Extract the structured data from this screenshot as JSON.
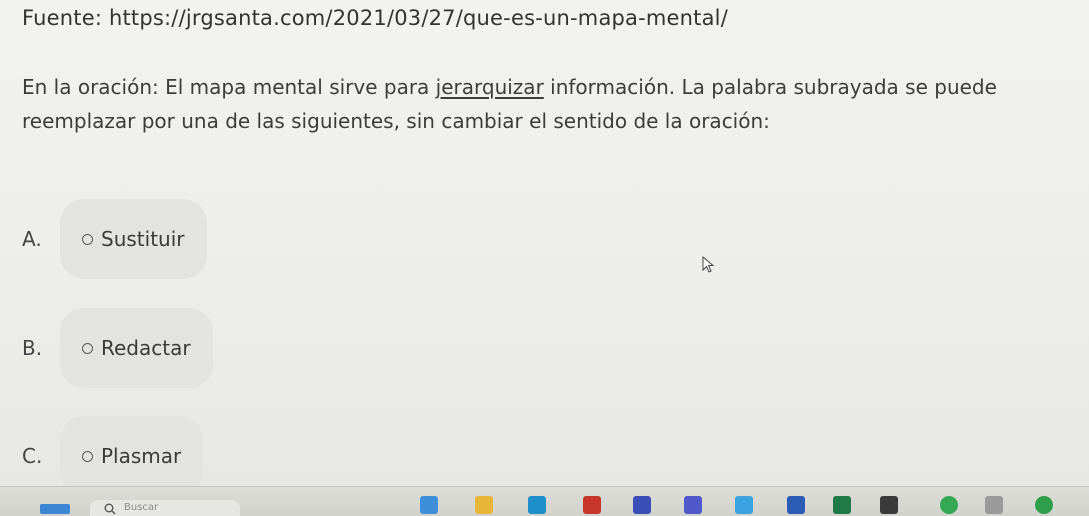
{
  "source": {
    "text": "Fuente: https://jrgsanta.com/2021/03/27/que-es-un-mapa-mental/"
  },
  "question": {
    "before": "En la oración: El mapa mental sirve para ",
    "underlined": "jerarquizar",
    "after": " información.  La palabra subrayada se puede reemplazar por una de las siguientes, sin cambiar el sentido de la oración:"
  },
  "options": [
    {
      "letter": "A.",
      "text": "Sustituir"
    },
    {
      "letter": "B.",
      "text": "Redactar"
    },
    {
      "letter": "C.",
      "text": "Plasmar"
    }
  ],
  "taskbar": {
    "search_placeholder": "Buscar",
    "apps": [
      {
        "name": "widgets-icon",
        "color": "#3f8fd8"
      },
      {
        "name": "file-explorer-icon",
        "color": "#e9b737"
      },
      {
        "name": "edge-icon",
        "color": "#1f8fc9"
      },
      {
        "name": "acrobat-icon",
        "color": "#c8352b"
      },
      {
        "name": "notes-icon",
        "color": "#3a4fb8"
      },
      {
        "name": "teams-icon",
        "color": "#5059c9"
      },
      {
        "name": "photos-icon",
        "color": "#3aa3e0"
      },
      {
        "name": "word-icon",
        "color": "#2b5bb5"
      },
      {
        "name": "excel-icon",
        "color": "#1f7a45"
      },
      {
        "name": "onenote-icon",
        "color": "#3a3a3a"
      },
      {
        "name": "chrome-icon",
        "color": "#34a853"
      },
      {
        "name": "tool-icon",
        "color": "#9a9a9a"
      },
      {
        "name": "chrome-canary-icon",
        "color": "#2f9e4a"
      }
    ]
  }
}
